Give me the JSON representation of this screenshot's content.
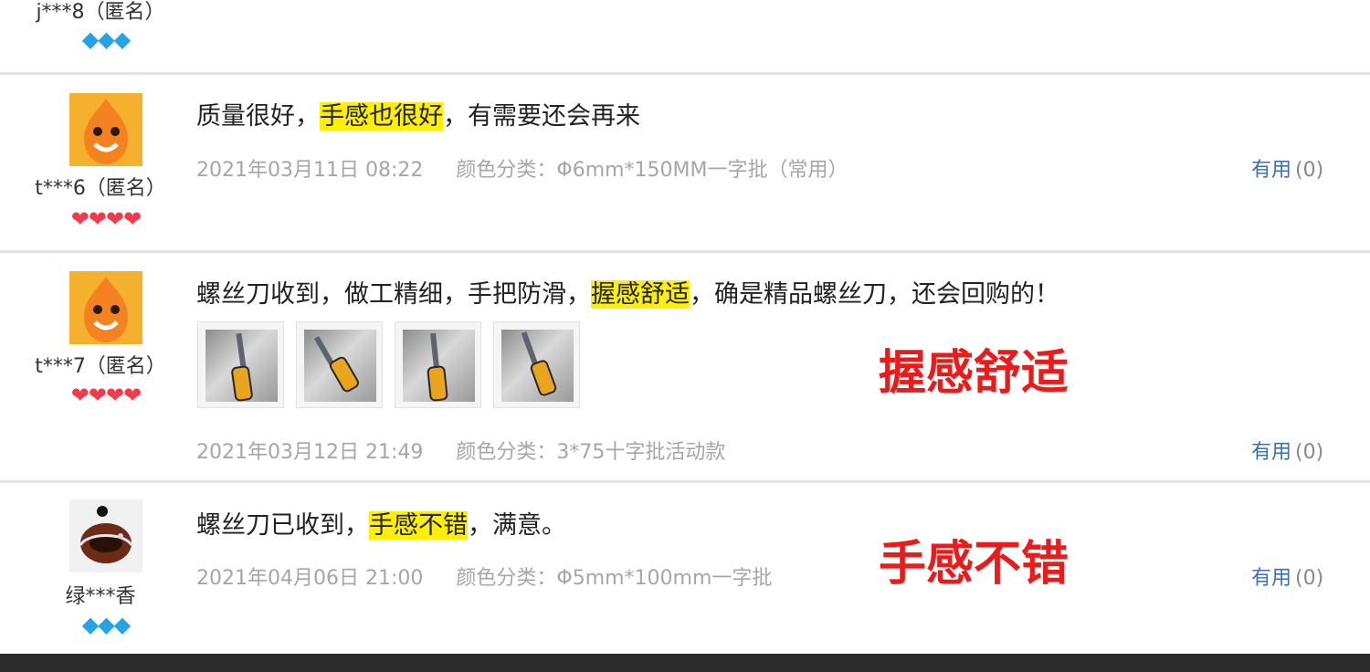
{
  "reviews": [
    {
      "username": "j***8（匿名）",
      "badges": "💎💎💎"
    },
    {
      "username": "t***6（匿名）",
      "badges": "❤❤❤❤",
      "comment_before": "质量很好，",
      "comment_highlight": "手感也很好",
      "comment_after": "，有需要还会再来",
      "date": "2021年03月11日 08:22",
      "category": "颜色分类：Φ6mm*150MM一字批（常用）",
      "useful_label": "有用",
      "useful_count": "(0)"
    },
    {
      "username": "t***7（匿名）",
      "badges": "❤❤❤❤",
      "comment_before": "螺丝刀收到，做工精细，手把防滑，",
      "comment_highlight": "握感舒适",
      "comment_after": "，确是精品螺丝刀，还会回购的！",
      "date": "2021年03月12日 21:49",
      "category": "颜色分类：3*75十字批活动款",
      "useful_label": "有用",
      "useful_count": "(0)",
      "callout": "握感舒适"
    },
    {
      "username": "绿***香",
      "badges": "💎💎💎",
      "comment_before": "螺丝刀已收到，",
      "comment_highlight": "手感不错",
      "comment_after": "，满意。",
      "date": "2021年04月06日 21:00",
      "category": "颜色分类：Φ5mm*100mm一字批",
      "useful_label": "有用",
      "useful_count": "(0)",
      "callout": "手感不错"
    }
  ],
  "colors": {
    "highlight": "#fff000",
    "callout": "#ea1b1b",
    "link": "#3b6fb6",
    "meta": "#a6a6a6",
    "heart": "#ef3b4d",
    "diamond": "#26a3e8"
  }
}
